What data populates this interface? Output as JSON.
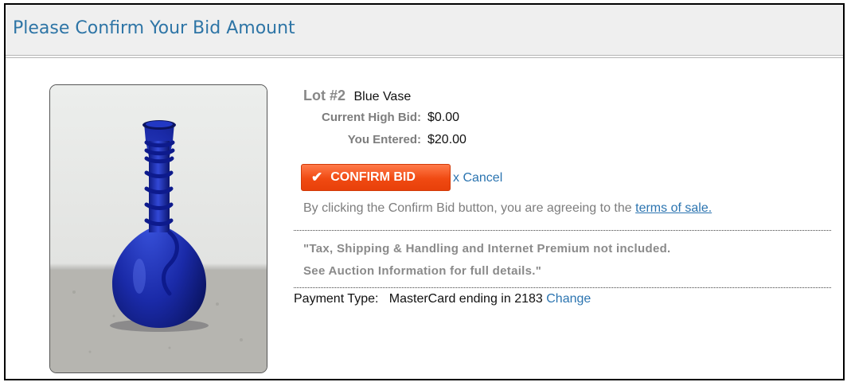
{
  "header": {
    "title": "Please Confirm Your Bid Amount"
  },
  "lot": {
    "number_label": "Lot #2",
    "name": "Blue Vase"
  },
  "bid": {
    "current_high_bid_label": "Current High Bid:",
    "current_high_bid_value": "$0.00",
    "you_entered_label": "You Entered:",
    "you_entered_value": "$20.00"
  },
  "actions": {
    "confirm_label": "CONFIRM BID",
    "cancel_label": "x Cancel",
    "check_icon": "checkmark-icon"
  },
  "agreement": {
    "text": "By clicking the Confirm Bid button, you are agreeing to the ",
    "link_text": "terms of sale."
  },
  "notice": {
    "line1": "\"Tax, Shipping & Handling and Internet Premium not included.",
    "line2": "See Auction Information for full details.\""
  },
  "payment": {
    "label": "Payment Type:",
    "value": "MasterCard ending in 2183",
    "change_label": "Change"
  },
  "colors": {
    "title": "#2e75a6",
    "link": "#2b74b0",
    "button": "#f04a12",
    "vase": "#1c2fb0"
  }
}
